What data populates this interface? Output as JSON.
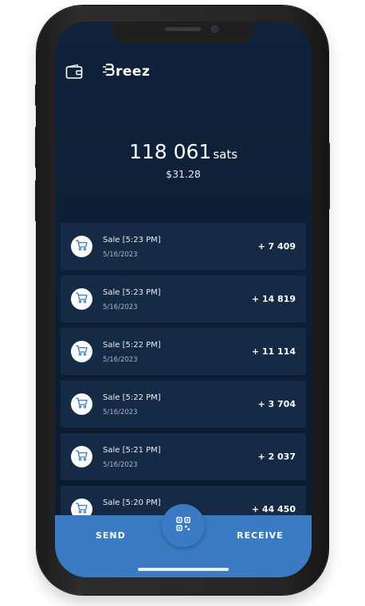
{
  "app": {
    "logo_text": "reez"
  },
  "balance": {
    "amount": "118 061",
    "unit": "sats",
    "fiat": "$31.28"
  },
  "transactions": [
    {
      "title": "Sale [5:23 PM]",
      "date": "5/16/2023",
      "amount": "+ 7 409"
    },
    {
      "title": "Sale [5:23 PM]",
      "date": "5/16/2023",
      "amount": "+ 14 819"
    },
    {
      "title": "Sale [5:22 PM]",
      "date": "5/16/2023",
      "amount": "+ 11 114"
    },
    {
      "title": "Sale [5:22 PM]",
      "date": "5/16/2023",
      "amount": "+ 3 704"
    },
    {
      "title": "Sale [5:21 PM]",
      "date": "5/16/2023",
      "amount": "+ 2 037"
    },
    {
      "title": "Sale [5:20 PM]",
      "date": "",
      "amount": "+ 44 450"
    }
  ],
  "bottom_bar": {
    "send_label": "SEND",
    "receive_label": "RECEIVE"
  },
  "icons": {
    "wallet": "wallet-icon",
    "logo": "breez-logo-icon",
    "cart": "shopping-cart-icon",
    "scan": "qr-scan-icon"
  },
  "colors": {
    "background": "#0d2036",
    "card": "#152a44",
    "accent": "#3a7bc4",
    "text": "#ffffff"
  }
}
